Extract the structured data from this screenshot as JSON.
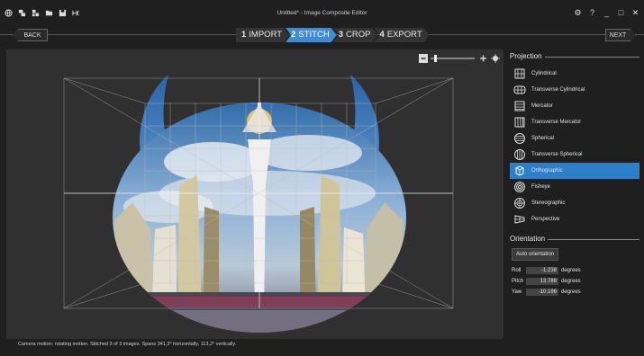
{
  "window": {
    "title": "Untitled* - Image Composite Editor",
    "controls": [
      "⚙",
      "?",
      "_",
      "□",
      "✕"
    ]
  },
  "toolbar_icons": [
    "globe-icon",
    "new-project-icon",
    "open-project-icon",
    "folder-icon",
    "save-icon",
    "publish-icon"
  ],
  "nav": {
    "back_label": "BACK",
    "next_label": "NEXT",
    "steps": [
      {
        "num": "1",
        "label": "IMPORT",
        "active": false
      },
      {
        "num": "2",
        "label": "STITCH",
        "active": true
      },
      {
        "num": "3",
        "label": "CROP",
        "active": false
      },
      {
        "num": "4",
        "label": "EXPORT",
        "active": false
      }
    ]
  },
  "zoom": {
    "minus": "−",
    "plus": "+",
    "level": 0.1
  },
  "projection": {
    "title": "Projection",
    "items": [
      {
        "label": "Cylindrical",
        "icon": "cylindrical-icon",
        "selected": false
      },
      {
        "label": "Transverse Cylindrical",
        "icon": "transverse-cylindrical-icon",
        "selected": false
      },
      {
        "label": "Mercator",
        "icon": "mercator-icon",
        "selected": false
      },
      {
        "label": "Transverse Mercator",
        "icon": "transverse-mercator-icon",
        "selected": false
      },
      {
        "label": "Spherical",
        "icon": "spherical-icon",
        "selected": false
      },
      {
        "label": "Transverse Spherical",
        "icon": "transverse-spherical-icon",
        "selected": false
      },
      {
        "label": "Orthographic",
        "icon": "orthographic-icon",
        "selected": true
      },
      {
        "label": "Fisheye",
        "icon": "fisheye-icon",
        "selected": false
      },
      {
        "label": "Stereographic",
        "icon": "stereographic-icon",
        "selected": false
      },
      {
        "label": "Perspective",
        "icon": "perspective-icon",
        "selected": false
      }
    ]
  },
  "orientation": {
    "title": "Orientation",
    "auto_label": "Auto orientation",
    "roll": {
      "label": "Roll",
      "value": "-1.238",
      "unit": "degrees"
    },
    "pitch": {
      "label": "Pitch",
      "value": "13.788",
      "unit": "degrees"
    },
    "yaw": {
      "label": "Yaw",
      "value": "-10.196",
      "unit": "degrees"
    }
  },
  "status_text": "Camera motion: rotating motion. Stitched 3 of 3 images. Spans 341,3° horizontally, 113,2° vertically.",
  "colors": {
    "accent": "#3a8ed8",
    "selected": "#2e7fc9",
    "sky": "#5d8fc2"
  }
}
